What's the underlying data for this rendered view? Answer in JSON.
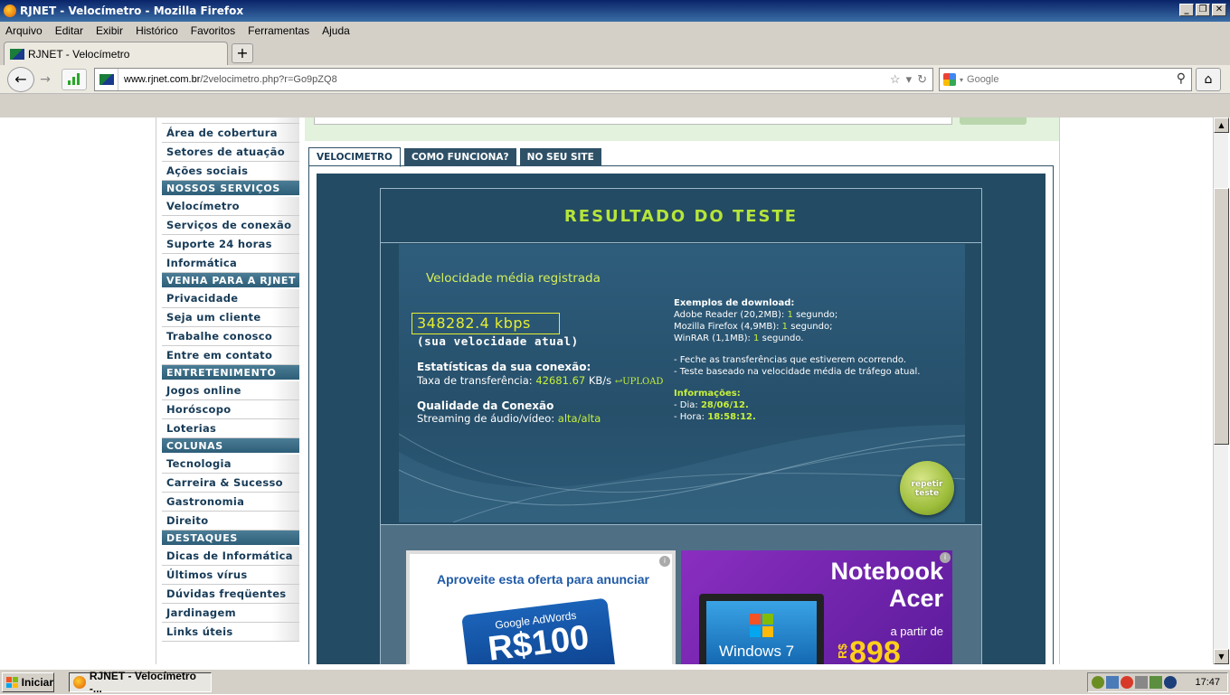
{
  "window": {
    "title": "RJNET - Velocímetro - Mozilla Firefox",
    "buttons": [
      "_",
      "❐",
      "✕"
    ]
  },
  "menu": [
    "Arquivo",
    "Editar",
    "Exibir",
    "Histórico",
    "Favoritos",
    "Ferramentas",
    "Ajuda"
  ],
  "tab": {
    "label": "RJNET - Velocímetro",
    "new_tab": "+"
  },
  "urlbar": {
    "host": "www.rjnet.com.br",
    "path": "/2velocimetro.php?r=Go9pZQ8"
  },
  "search": {
    "placeholder": "Google"
  },
  "sidebar": {
    "items": [
      {
        "type": "item",
        "label": "Área de cobertura"
      },
      {
        "type": "item",
        "label": "Setores de atuação"
      },
      {
        "type": "item",
        "label": "Ações sociais"
      },
      {
        "type": "head",
        "label": "NOSSOS SERVIÇOS"
      },
      {
        "type": "item",
        "label": "Velocímetro"
      },
      {
        "type": "item",
        "label": "Serviços de conexão"
      },
      {
        "type": "item",
        "label": "Suporte 24 horas"
      },
      {
        "type": "item",
        "label": "Informática"
      },
      {
        "type": "head",
        "label": "VENHA PARA A RJNET"
      },
      {
        "type": "item",
        "label": "Privacidade"
      },
      {
        "type": "item",
        "label": "Seja um cliente"
      },
      {
        "type": "item",
        "label": "Trabalhe conosco"
      },
      {
        "type": "item",
        "label": "Entre em contato"
      },
      {
        "type": "head",
        "label": "ENTRETENIMENTO"
      },
      {
        "type": "item",
        "label": "Jogos online"
      },
      {
        "type": "item",
        "label": "Horóscopo"
      },
      {
        "type": "item",
        "label": "Loterias"
      },
      {
        "type": "head",
        "label": "COLUNAS"
      },
      {
        "type": "item",
        "label": "Tecnologia"
      },
      {
        "type": "item",
        "label": "Carreira & Sucesso"
      },
      {
        "type": "item",
        "label": "Gastronomia"
      },
      {
        "type": "item",
        "label": "Direito"
      },
      {
        "type": "head",
        "label": "DESTAQUES"
      },
      {
        "type": "item",
        "label": "Dicas de Informática"
      },
      {
        "type": "item",
        "label": "Últimos vírus"
      },
      {
        "type": "item",
        "label": "Dúvidas freqüentes"
      },
      {
        "type": "item",
        "label": "Jardinagem"
      },
      {
        "type": "item",
        "label": "Links úteis"
      }
    ]
  },
  "tabs": [
    "VELOCIMETRO",
    "COMO FUNCIONA?",
    "NO SEU SITE"
  ],
  "result": {
    "title": "RESULTADO DO TESTE",
    "vel_label": "Velocidade média registrada",
    "speed": "348282.4 kbps",
    "speed_sub": "(sua velocidade atual)",
    "stats_title": "Estatísticas da sua conexão:",
    "transfer_label": "Taxa de transferência:",
    "transfer_value": "42681.67",
    "transfer_unit": "KB/s",
    "upload": "↩UPLOAD",
    "quality_title": "Qualidade da Conexão",
    "streaming_label": "Streaming de áudio/vídeo:",
    "streaming_value": "alta/alta",
    "examples_title": "Exemplos de download:",
    "examples": [
      {
        "name": "Adobe Reader (20,2MB):",
        "value": "1",
        "unit": "segundo;"
      },
      {
        "name": "Mozilla Firefox (4,9MB):",
        "value": "1",
        "unit": "segundo;"
      },
      {
        "name": "WinRAR (1,1MB):",
        "value": "1",
        "unit": "segundo."
      }
    ],
    "notes": [
      "- Feche as transferências que estiverem ocorrendo.",
      "- Teste baseado na velocidade média de tráfego atual."
    ],
    "info_title": "Informações:",
    "day_label": "- Dia:",
    "day_value": "28/06/12.",
    "hour_label": "- Hora:",
    "hour_value": "18:58:12.",
    "repeat_line1": "repetir",
    "repeat_line2": "teste"
  },
  "ads": {
    "ad1_text": "Aproveite esta oferta para anunciar",
    "ad1_brand": "Google AdWords",
    "ad1_amount": "R$100",
    "ad2_title": "Notebook Acer",
    "ad2_os": "Windows 7",
    "ad2_sub": "a partir de",
    "ad2_currency": "R$",
    "ad2_price": "898",
    "info": "i"
  },
  "taskbar": {
    "start": "Iniciar",
    "item": "RJNET - Velocímetro -...",
    "clock": "17:47"
  },
  "colors": {
    "accent_green": "#b6e53a",
    "dark_panel": "#234b63",
    "sidebar_text": "#173b57"
  }
}
